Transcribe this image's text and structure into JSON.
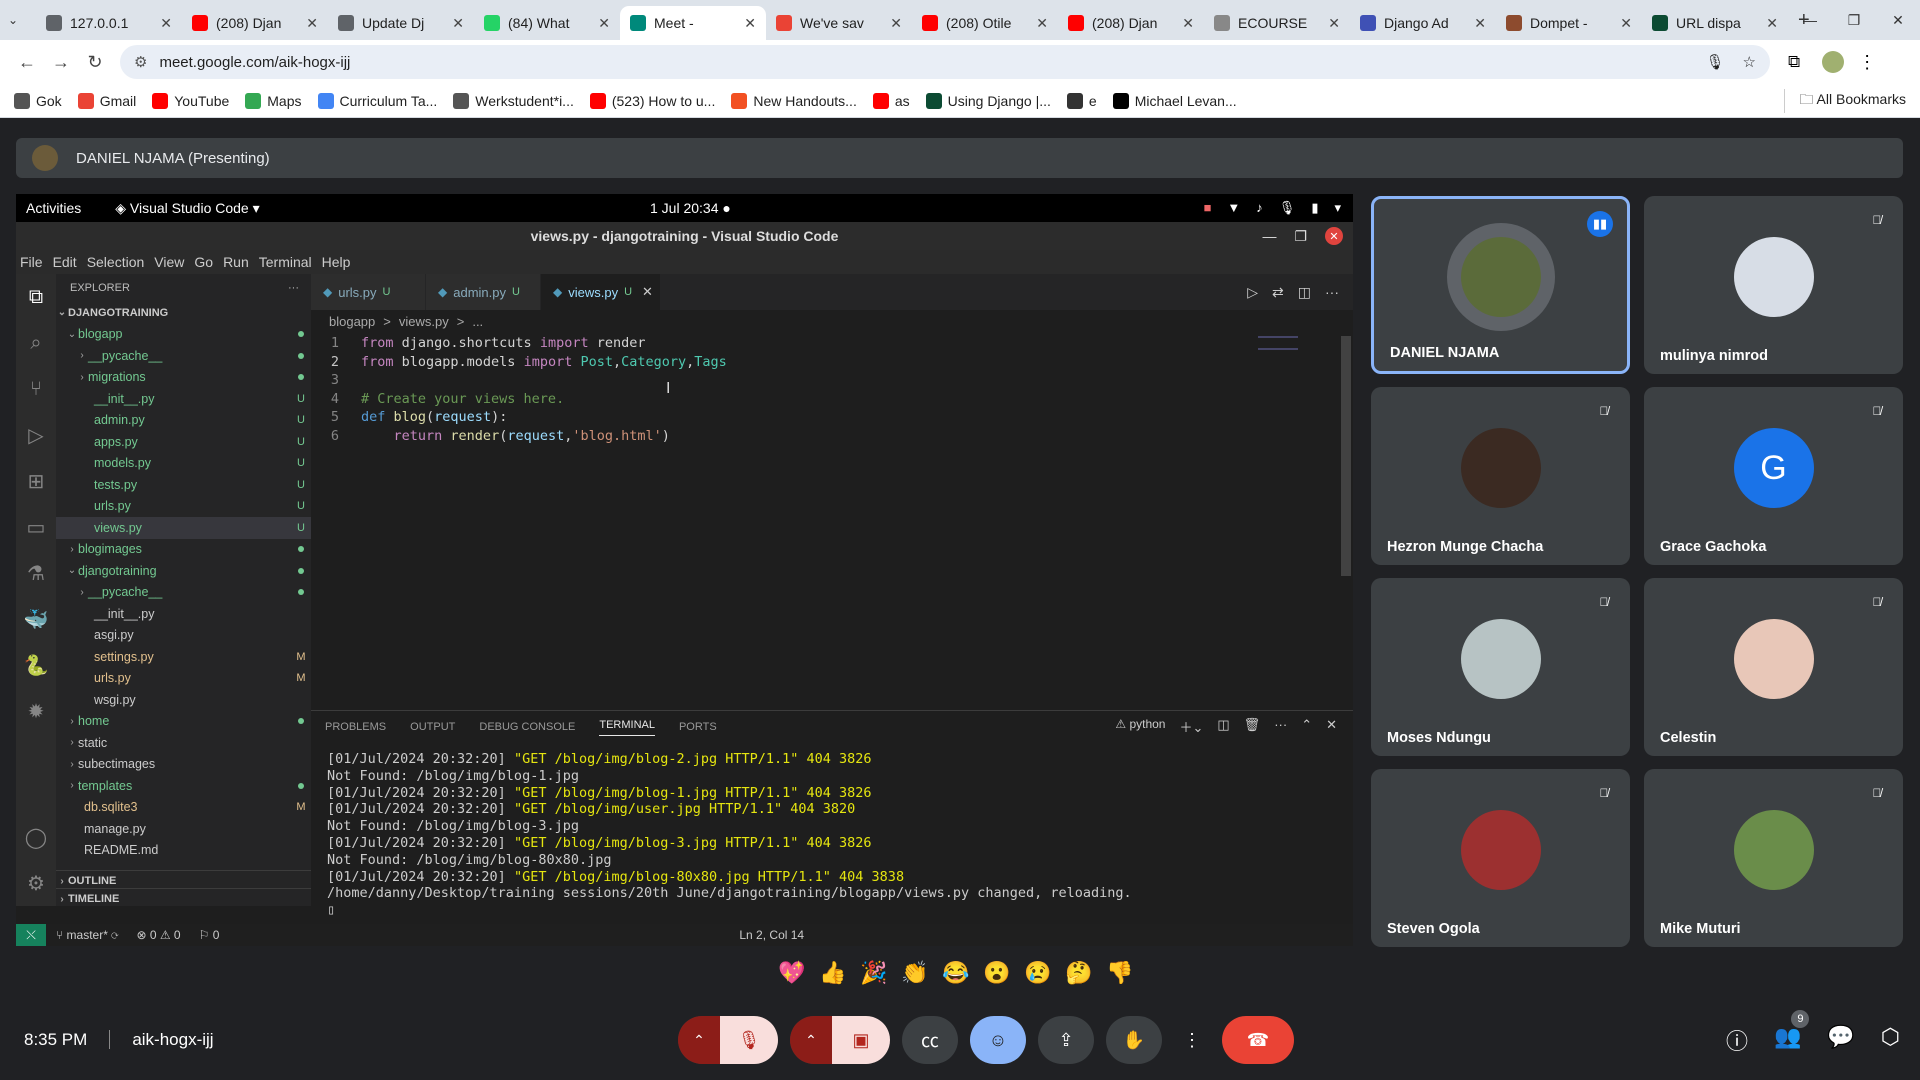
{
  "browser": {
    "tabs": [
      {
        "title": "127.0.0.1",
        "color": "#5f6368"
      },
      {
        "title": "(208) Djan",
        "color": "#ff0000"
      },
      {
        "title": "Update Dj",
        "color": "#5f6368"
      },
      {
        "title": "(84) What",
        "color": "#25d366"
      },
      {
        "title": "Meet - ",
        "color": "#00897b"
      },
      {
        "title": "We've sav",
        "color": "#ea4335"
      },
      {
        "title": "(208) Otile",
        "color": "#ff0000"
      },
      {
        "title": "(208) Djan",
        "color": "#ff0000"
      },
      {
        "title": "ECOURSE",
        "color": "#888888"
      },
      {
        "title": "Django Ad",
        "color": "#3f51b5"
      },
      {
        "title": "Dompet -",
        "color": "#8d4b2e"
      },
      {
        "title": "URL dispa",
        "color": "#0c4b33"
      }
    ],
    "url": "meet.google.com/aik-hogx-ijj",
    "bookmarks": [
      {
        "label": "Gok",
        "color": "#555"
      },
      {
        "label": "Gmail",
        "color": "#ea4335"
      },
      {
        "label": "YouTube",
        "color": "#ff0000"
      },
      {
        "label": "Maps",
        "color": "#34a853"
      },
      {
        "label": "Curriculum Ta...",
        "color": "#4285f4"
      },
      {
        "label": "Werkstudent*i...",
        "color": "#555"
      },
      {
        "label": "(523) How to u...",
        "color": "#ff0000"
      },
      {
        "label": "New Handouts...",
        "color": "#f25022"
      },
      {
        "label": "as",
        "color": "#ff0000"
      },
      {
        "label": "Using Django |...",
        "color": "#0c4b33"
      },
      {
        "label": "e",
        "color": "#333"
      },
      {
        "label": "Michael Levan...",
        "color": "#000"
      }
    ],
    "all_bookmarks": "All Bookmarks"
  },
  "presenter": {
    "label": "DANIEL NJAMA (Presenting)"
  },
  "screen": {
    "activities": "Activities",
    "app_name": "Visual Studio Code",
    "clock": "1 Jul  20:34",
    "window_title": "views.py - djangotraining - Visual Studio Code",
    "menu": [
      "File",
      "Edit",
      "Selection",
      "View",
      "Go",
      "Run",
      "Terminal",
      "Help"
    ],
    "explorer_label": "EXPLORER",
    "project": "DJANGOTRAINING",
    "tree": [
      {
        "name": "blogapp",
        "indent": 1,
        "folder": true,
        "open": true,
        "badge": "dot"
      },
      {
        "name": "__pycache__",
        "indent": 2,
        "folder": true,
        "badge": "dot"
      },
      {
        "name": "migrations",
        "indent": 2,
        "folder": true,
        "badge": "dot"
      },
      {
        "name": "__init__.py",
        "indent": 2,
        "badge": "U"
      },
      {
        "name": "admin.py",
        "indent": 2,
        "badge": "U"
      },
      {
        "name": "apps.py",
        "indent": 2,
        "badge": "U"
      },
      {
        "name": "models.py",
        "indent": 2,
        "badge": "U"
      },
      {
        "name": "tests.py",
        "indent": 2,
        "badge": "U"
      },
      {
        "name": "urls.py",
        "indent": 2,
        "badge": "U"
      },
      {
        "name": "views.py",
        "indent": 2,
        "badge": "U",
        "selected": true
      },
      {
        "name": "blogimages",
        "indent": 1,
        "folder": true,
        "badge": "dot"
      },
      {
        "name": "djangotraining",
        "indent": 1,
        "folder": true,
        "open": true,
        "badge": "dot"
      },
      {
        "name": "__pycache__",
        "indent": 2,
        "folder": true,
        "badge": "dot"
      },
      {
        "name": "__init__.py",
        "indent": 2,
        "badge": ""
      },
      {
        "name": "asgi.py",
        "indent": 2,
        "badge": ""
      },
      {
        "name": "settings.py",
        "indent": 2,
        "badge": "M"
      },
      {
        "name": "urls.py",
        "indent": 2,
        "badge": "M"
      },
      {
        "name": "wsgi.py",
        "indent": 2,
        "badge": ""
      },
      {
        "name": "home",
        "indent": 1,
        "folder": true,
        "badge": "dot"
      },
      {
        "name": "static",
        "indent": 1,
        "folder": true,
        "badge": ""
      },
      {
        "name": "subectimages",
        "indent": 1,
        "folder": true,
        "badge": ""
      },
      {
        "name": "templates",
        "indent": 1,
        "folder": true,
        "badge": "dot"
      },
      {
        "name": "db.sqlite3",
        "indent": 1,
        "badge": "M"
      },
      {
        "name": "manage.py",
        "indent": 1,
        "badge": ""
      },
      {
        "name": "README.md",
        "indent": 1,
        "badge": ""
      }
    ],
    "outline": "OUTLINE",
    "timeline": "TIMELINE",
    "editor_tabs": [
      {
        "name": "urls.py",
        "status": "U"
      },
      {
        "name": "admin.py",
        "status": "U"
      },
      {
        "name": "views.py",
        "status": "U"
      }
    ],
    "breadcrumb": [
      "blogapp",
      ">",
      "views.py",
      ">",
      "..."
    ],
    "code_lines": [
      {
        "n": "1",
        "parts": [
          [
            "kw",
            "from"
          ],
          [
            "tx",
            " django.shortcuts "
          ],
          [
            "kw",
            "import"
          ],
          [
            "tx",
            " render"
          ]
        ]
      },
      {
        "n": "2",
        "parts": [
          [
            "kw",
            "from"
          ],
          [
            "tx",
            " blogapp.models "
          ],
          [
            "kw",
            "import"
          ],
          [
            "cls",
            " Post"
          ],
          [
            "tx",
            ","
          ],
          [
            "cls",
            "Category"
          ],
          [
            "tx",
            ","
          ],
          [
            "cls",
            "Tags"
          ]
        ]
      },
      {
        "n": "3",
        "parts": []
      },
      {
        "n": "4",
        "parts": [
          [
            "cm",
            "# Create your views here."
          ]
        ]
      },
      {
        "n": "5",
        "parts": [
          [
            "kw2",
            "def"
          ],
          [
            "fn",
            " blog"
          ],
          [
            "tx",
            "("
          ],
          [
            "var",
            "request"
          ],
          [
            "tx",
            "):"
          ]
        ]
      },
      {
        "n": "6",
        "parts": [
          [
            "tx",
            "    "
          ],
          [
            "kw",
            "return"
          ],
          [
            "fn",
            " render"
          ],
          [
            "tx",
            "("
          ],
          [
            "var",
            "request"
          ],
          [
            "tx",
            ","
          ],
          [
            "str",
            "'blog.html'"
          ],
          [
            "tx",
            ")"
          ]
        ]
      }
    ],
    "panel_tabs": [
      "PROBLEMS",
      "OUTPUT",
      "DEBUG CONSOLE",
      "TERMINAL",
      "PORTS"
    ],
    "terminal_shell": "python",
    "terminal_lines": [
      {
        "pre": "[01/Jul/2024 20:32:20] ",
        "hi": "\"GET /blog/img/blog-2.jpg HTTP/1.1\" 404 3826"
      },
      {
        "pre": "Not Found: /blog/img/blog-1.jpg",
        "hi": ""
      },
      {
        "pre": "[01/Jul/2024 20:32:20] ",
        "hi": "\"GET /blog/img/blog-1.jpg HTTP/1.1\" 404 3826"
      },
      {
        "pre": "[01/Jul/2024 20:32:20] ",
        "hi": "\"GET /blog/img/user.jpg HTTP/1.1\" 404 3820"
      },
      {
        "pre": "Not Found: /blog/img/blog-3.jpg",
        "hi": ""
      },
      {
        "pre": "[01/Jul/2024 20:32:20] ",
        "hi": "\"GET /blog/img/blog-3.jpg HTTP/1.1\" 404 3826"
      },
      {
        "pre": "Not Found: /blog/img/blog-80x80.jpg",
        "hi": ""
      },
      {
        "pre": "[01/Jul/2024 20:32:20] ",
        "hi": "\"GET /blog/img/blog-80x80.jpg HTTP/1.1\" 404 3838"
      },
      {
        "pre": "/home/danny/Desktop/training sessions/20th June/djangotraining/blogapp/views.py changed, reloading.",
        "hi": ""
      }
    ],
    "status": {
      "branch": "master*",
      "problems": "⊗ 0 ⚠ 0",
      "ports": "⚐ 0",
      "position": "Ln 2, Col 14"
    }
  },
  "participants": [
    {
      "name": "DANIEL NJAMA",
      "speaking": true,
      "avatar_color": "#5b6b3a",
      "initial": ""
    },
    {
      "name": "mulinya nimrod",
      "avatar_color": "#d7dde6",
      "initial": ""
    },
    {
      "name": "Hezron Munge Chacha",
      "avatar_color": "#3b2a22",
      "initial": ""
    },
    {
      "name": "Grace Gachoka",
      "avatar_color": "#1a73e8",
      "initial": "G"
    },
    {
      "name": "Moses Ndungu",
      "avatar_color": "#b7c3c4",
      "initial": ""
    },
    {
      "name": "Celestin",
      "avatar_color": "#e8c7b8",
      "initial": ""
    },
    {
      "name": "Steven Ogola",
      "avatar_color": "#9c3030",
      "initial": ""
    },
    {
      "name": "Mike Muturi",
      "avatar_color": "#6a8d4a",
      "initial": ""
    }
  ],
  "reactions": [
    "💖",
    "👍",
    "🎉",
    "👏",
    "😂",
    "😮",
    "😢",
    "🤔",
    "👎"
  ],
  "meeting": {
    "time": "8:35 PM",
    "code": "aik-hogx-ijj",
    "participant_count": "9"
  }
}
